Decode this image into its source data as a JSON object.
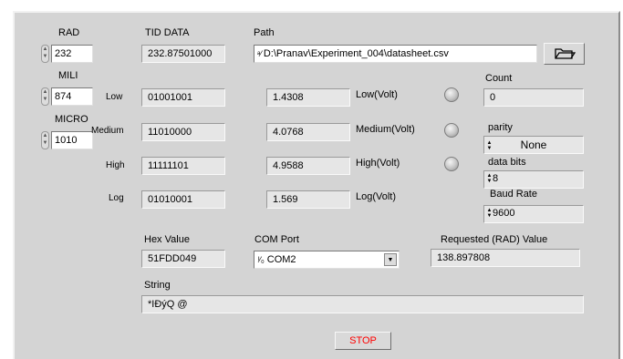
{
  "labels": {
    "rad": "RAD",
    "mili": "MILI",
    "micro": "MICRO",
    "tid_data": "TID DATA",
    "path": "Path",
    "count": "Count",
    "low": "Low",
    "medium": "Medium",
    "high": "High",
    "log": "Log",
    "low_volt": "Low(Volt)",
    "medium_volt": "Medium(Volt)",
    "high_volt": "High(Volt)",
    "log_volt": "Log(Volt)",
    "parity": "parity",
    "data_bits": "data bits",
    "baud_rate": "Baud Rate",
    "hex_value": "Hex Value",
    "com_port": "COM Port",
    "requested": "Requested (RAD) Value",
    "string": "String"
  },
  "values": {
    "rad": "232",
    "mili": "874",
    "micro": "1010",
    "tid_data": "232.87501000",
    "path": "D:\\Pranav\\Experiment_004\\datasheet.csv",
    "count": "0",
    "low_bits": "01001001",
    "medium_bits": "11010000",
    "high_bits": "11111101",
    "log_bits": "01010001",
    "low_volt": "1.4308",
    "medium_volt": "4.0768",
    "high_volt": "4.9588",
    "log_volt": "1.569",
    "parity": "None",
    "data_bits": "8",
    "baud_rate": "9600",
    "hex_value": "51FDD049",
    "com_port": "COM2",
    "requested": "138.897808",
    "string": "*IÐýQ @"
  },
  "buttons": {
    "stop": "STOP"
  },
  "icons": {
    "path_prefix": "path-icon",
    "browse": "folder-icon",
    "com_prefix": "io-icon",
    "dropdown": "dropdown-arrow-icon"
  },
  "colors": {
    "stop_text": "#ff0000",
    "panel": "#d4d4d4"
  }
}
